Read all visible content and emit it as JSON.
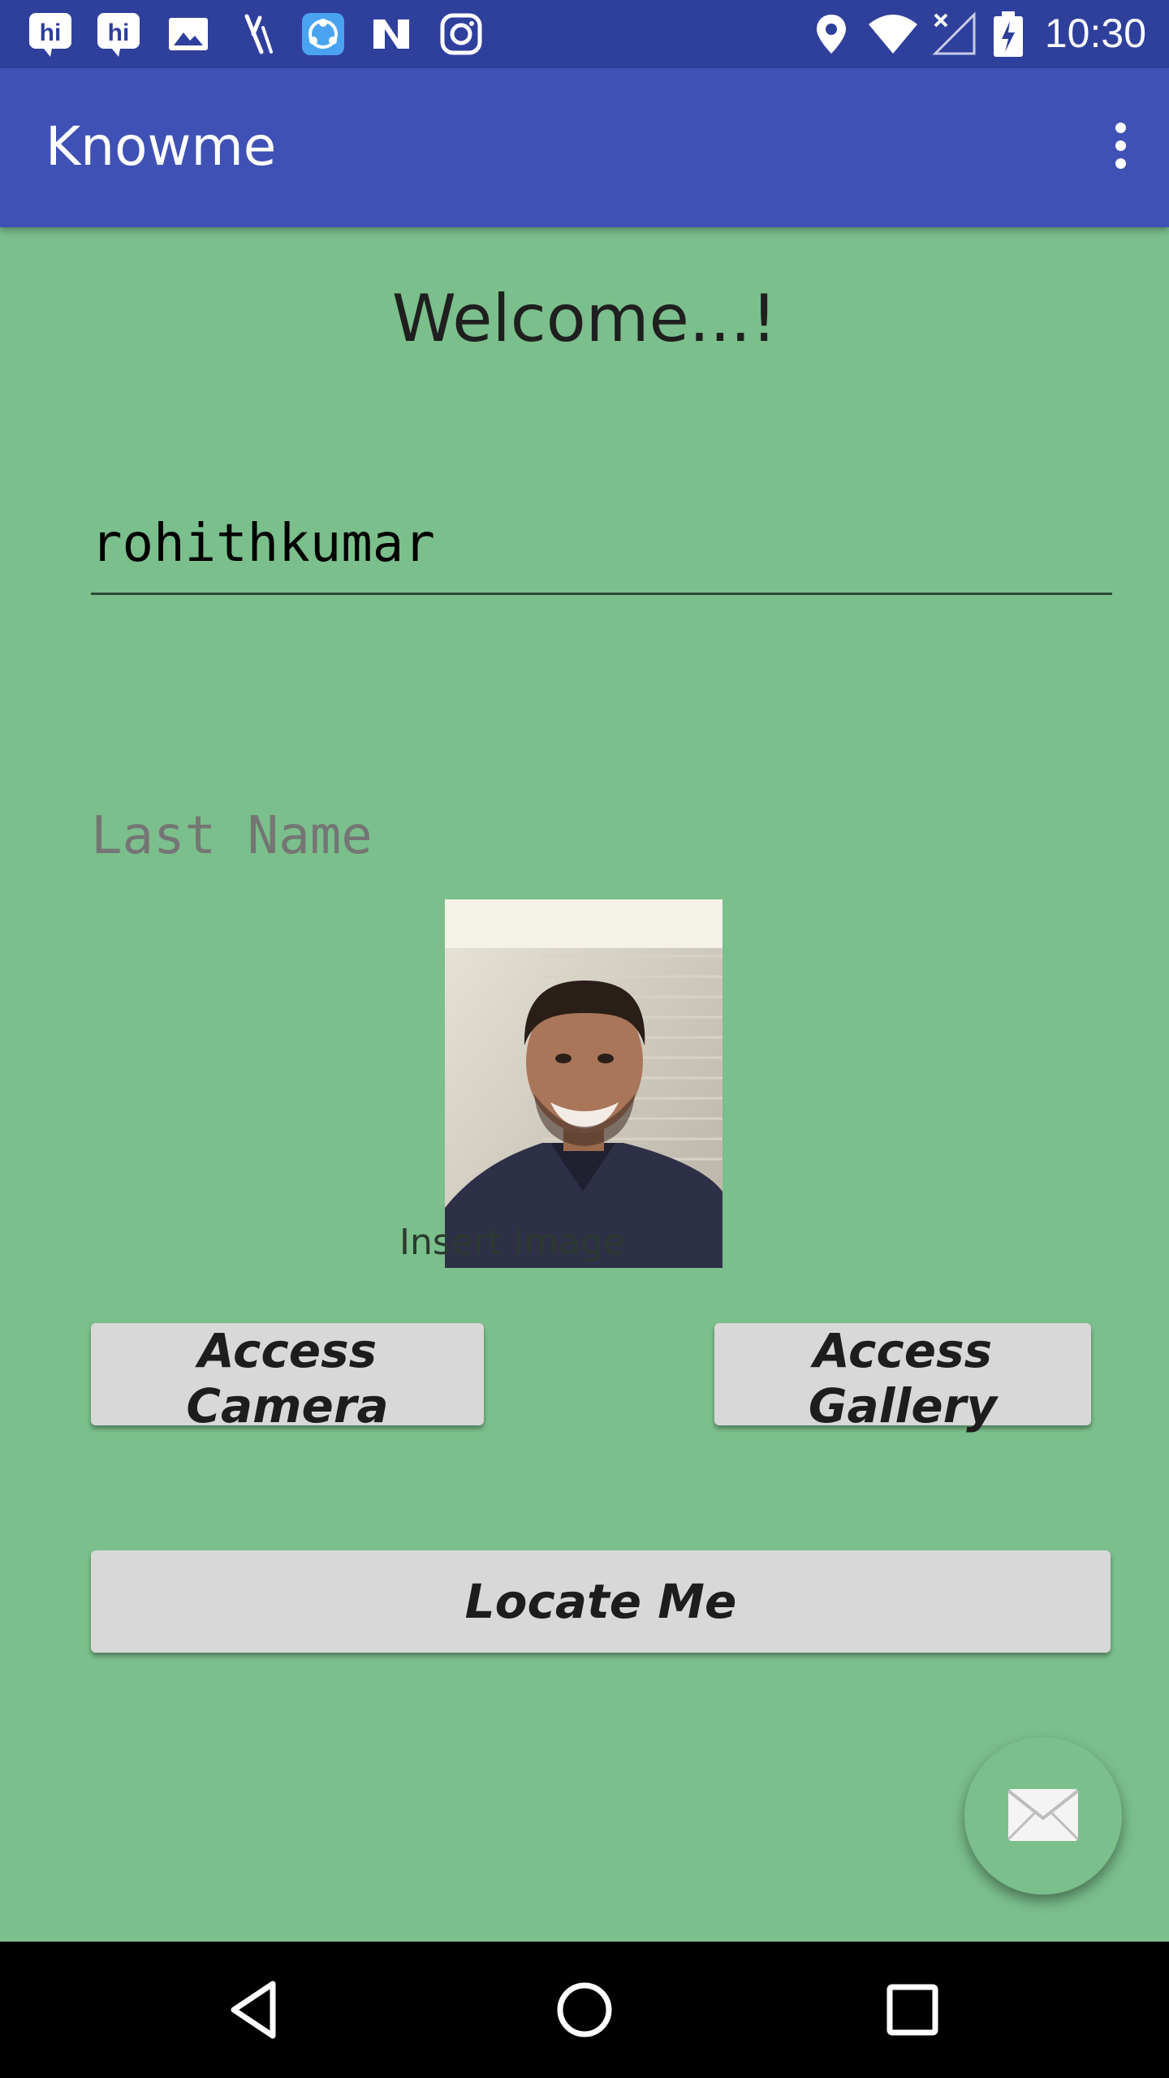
{
  "status_bar": {
    "time": "10:30",
    "left_icons": [
      "hike-icon",
      "hike-icon",
      "gallery-icon",
      "tool-icon",
      "sync-app-icon",
      "news-app-icon",
      "instagram-icon"
    ],
    "right_icons": [
      "location-icon",
      "wifi-icon",
      "signal-icon",
      "battery-icon"
    ]
  },
  "app_bar": {
    "title": "Knowme"
  },
  "main": {
    "welcome": "Welcome...!",
    "first_name_value": "rohithkumar",
    "last_name_placeholder": "Last Name",
    "insert_image_label": "Insert Image",
    "camera_button": "Access Camera",
    "gallery_button": "Access Gallery",
    "locate_button": "Locate Me"
  },
  "colors": {
    "background": "#7bbf8c",
    "app_bar": "#3f51b5",
    "status_bar": "#2f3f9c",
    "button": "#d7d8d7"
  }
}
